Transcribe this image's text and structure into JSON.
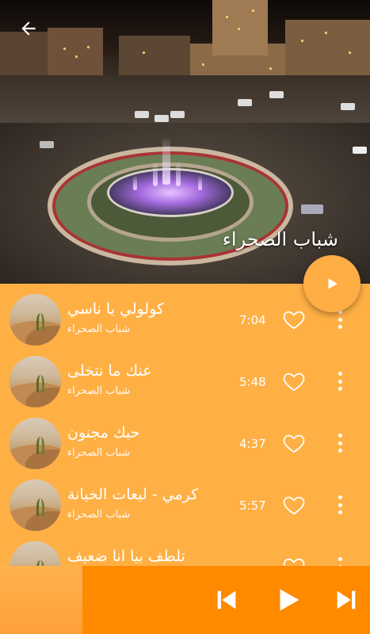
{
  "header": {
    "title": "شباب الصحراء",
    "back_icon": "arrow-left-icon"
  },
  "fab": {
    "icon": "play-icon"
  },
  "songs": [
    {
      "title": "كولولي يا ناسي",
      "artist": "شباب الصحراء",
      "duration": "7:04"
    },
    {
      "title": "عنك ما نتخلى",
      "artist": "شباب الصحراء",
      "duration": "5:48"
    },
    {
      "title": "حبك مجنون",
      "artist": "شباب الصحراء",
      "duration": "4:37"
    },
    {
      "title": "كرمي - ليعات الخيانة",
      "artist": "شباب الصحراء",
      "duration": "5:57"
    },
    {
      "title": "تلطف بيا انا ضعيف",
      "artist": "",
      "duration": ""
    }
  ],
  "player": {
    "prev_icon": "skip-previous-icon",
    "play_icon": "play-icon",
    "next_icon": "skip-next-icon"
  },
  "colors": {
    "accent": "#ffb044",
    "player_bar": "#ff8a00",
    "fab": "#ffad45"
  }
}
